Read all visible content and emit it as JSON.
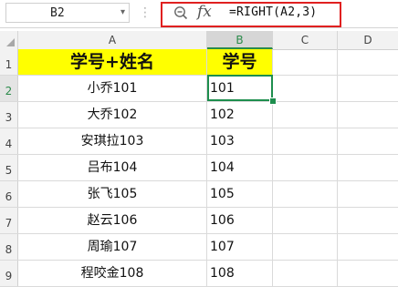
{
  "name_box": {
    "value": "B2"
  },
  "formula_bar": {
    "zoom_icon": "zoom-out-icon",
    "fx_label": "fx",
    "formula": "=RIGHT(A2,3)",
    "highlight_color": "#e02020"
  },
  "columns": [
    "A",
    "B",
    "C",
    "D"
  ],
  "selected_column": "B",
  "selected_row": "2",
  "accent_color": "#1e8e4e",
  "header_fill": "#ffff00",
  "rows": [
    {
      "num": "1",
      "a": "学号+姓名",
      "b": "学号"
    },
    {
      "num": "2",
      "a": "小乔101",
      "b": "101"
    },
    {
      "num": "3",
      "a": "大乔102",
      "b": "102"
    },
    {
      "num": "4",
      "a": "安琪拉103",
      "b": "103"
    },
    {
      "num": "5",
      "a": "吕布104",
      "b": "104"
    },
    {
      "num": "6",
      "a": "张飞105",
      "b": "105"
    },
    {
      "num": "7",
      "a": "赵云106",
      "b": "106"
    },
    {
      "num": "8",
      "a": "周瑜107",
      "b": "107"
    },
    {
      "num": "9",
      "a": "程咬金108",
      "b": "108"
    }
  ]
}
